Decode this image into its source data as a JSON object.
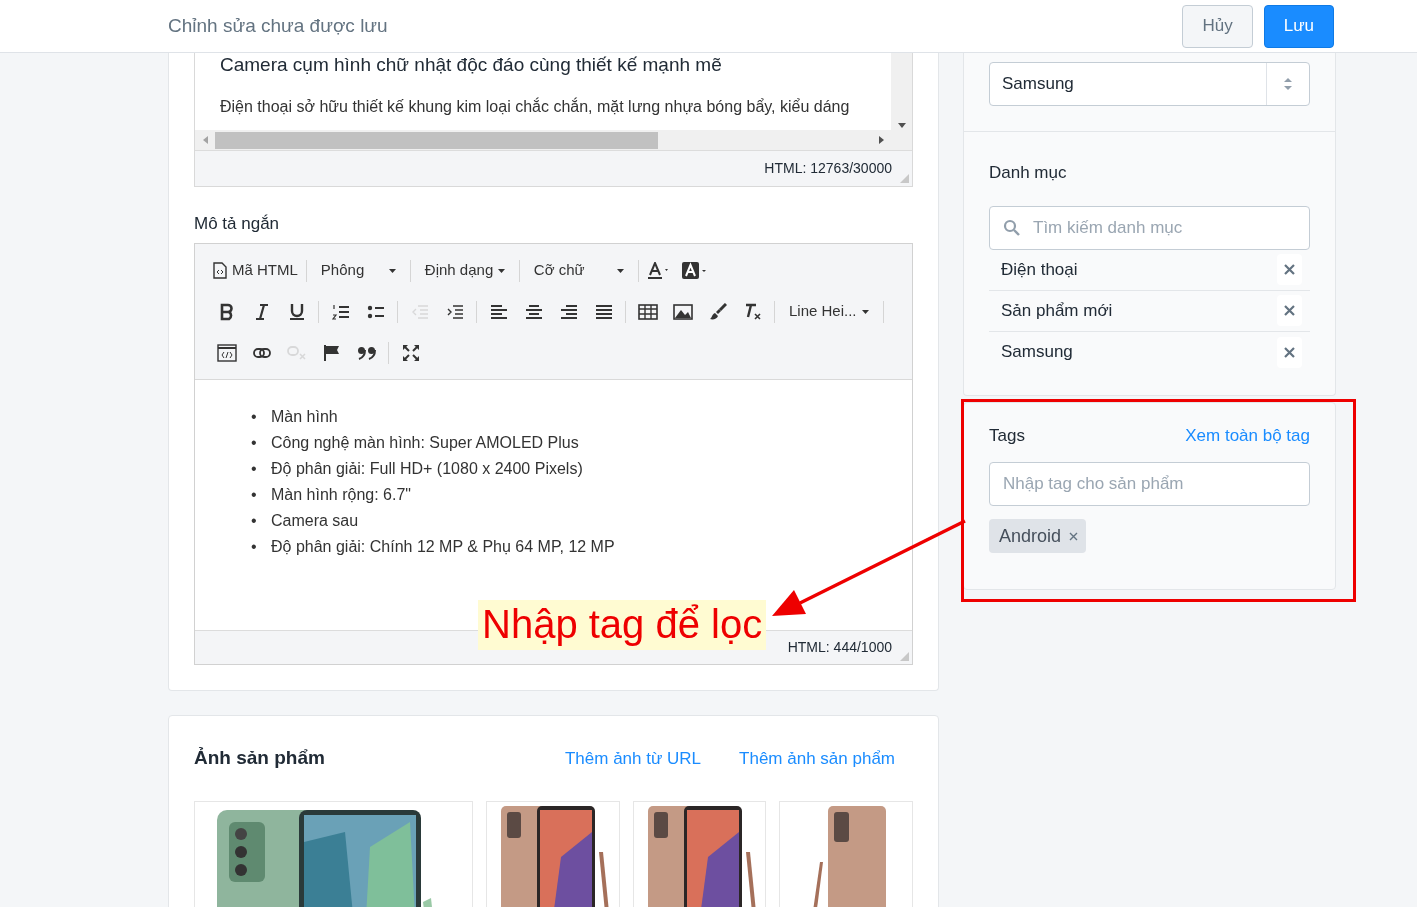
{
  "header": {
    "title": "Chỉnh sửa chưa được lưu",
    "buttons": [
      {
        "label": "Hủy",
        "kind": "secondary"
      },
      {
        "label": "Lưu",
        "kind": "primary"
      }
    ]
  },
  "description_editor": {
    "heading": "Camera cụm hình chữ nhật độc đáo cùng thiết kế mạnh mẽ",
    "paragraph_lines": [
      "Điện thoại sở hữu thiết kế khung kim loại chắc chắn, mặt lưng nhựa bóng bẩy, kiểu dáng"
    ],
    "counter": "HTML: 12763/30000"
  },
  "short_description": {
    "label": "Mô tả ngắn",
    "toolbar": [
      [
        {
          "kind": "button",
          "label": "Mã HTML"
        },
        {
          "kind": "separator"
        },
        {
          "kind": "dropdown",
          "label": "Phông"
        },
        {
          "kind": "separator"
        },
        {
          "kind": "dropdown",
          "label": "Định dạng"
        },
        {
          "kind": "separator"
        },
        {
          "kind": "dropdown",
          "label": "Cỡ chữ"
        },
        {
          "kind": "separator"
        },
        {
          "kind": "icon",
          "disabled": false
        },
        {
          "kind": "icon",
          "disabled": false
        }
      ],
      [
        {
          "kind": "icon",
          "disabled": false
        },
        {
          "kind": "icon",
          "disabled": false
        },
        {
          "kind": "icon",
          "disabled": false
        },
        {
          "kind": "separator"
        },
        {
          "kind": "icon",
          "disabled": false
        },
        {
          "kind": "icon",
          "disabled": false
        },
        {
          "kind": "separator"
        },
        {
          "kind": "icon",
          "disabled": true
        },
        {
          "kind": "icon",
          "disabled": false
        },
        {
          "kind": "separator"
        },
        {
          "kind": "icon",
          "disabled": false
        },
        {
          "kind": "icon",
          "disabled": false
        },
        {
          "kind": "icon",
          "disabled": false
        },
        {
          "kind": "icon",
          "disabled": false
        },
        {
          "kind": "separator"
        },
        {
          "kind": "icon",
          "disabled": false
        },
        {
          "kind": "icon",
          "disabled": false
        },
        {
          "kind": "icon",
          "disabled": false
        },
        {
          "kind": "icon",
          "disabled": false
        },
        {
          "kind": "separator"
        },
        {
          "kind": "dropdown",
          "label": "Line Hei..."
        },
        {
          "kind": "separator"
        }
      ],
      [
        {
          "kind": "icon",
          "disabled": false
        },
        {
          "kind": "icon",
          "disabled": false
        },
        {
          "kind": "icon",
          "disabled": true
        },
        {
          "kind": "icon",
          "disabled": false
        },
        {
          "kind": "icon",
          "disabled": false
        },
        {
          "kind": "separator"
        },
        {
          "kind": "icon",
          "disabled": false
        }
      ]
    ],
    "bullets": [
      {
        "marker": "•",
        "text": "Màn hình"
      },
      {
        "marker": "•",
        "text": "Công nghệ màn hình: Super AMOLED Plus"
      },
      {
        "marker": "•",
        "text": "Độ phân giải: Full HD+ (1080 x 2400 Pixels)"
      },
      {
        "marker": "•",
        "text": "Màn hình rộng: 6.7\""
      },
      {
        "marker": "•",
        "text": "Camera sau"
      },
      {
        "marker": "•",
        "text": "Độ phân giải: Chính 12 MP & Phụ 64 MP, 12 MP"
      }
    ],
    "counter": "HTML: 444/1000"
  },
  "annotation": {
    "text": "Nhập tag để lọc"
  },
  "product_images": {
    "title": "Ảnh sản phẩm",
    "links": [
      "Thêm ảnh từ URL",
      "Thêm ảnh sản phẩm"
    ],
    "images": [
      {
        "kind": "picture"
      },
      {
        "kind": "picture"
      },
      {
        "kind": "picture"
      },
      {
        "kind": "picture"
      }
    ]
  },
  "brand_select": {
    "value": "Samsung"
  },
  "categories": {
    "title": "Danh mục",
    "search_placeholder": "Tìm kiếm danh mục",
    "items": [
      "Điện thoại",
      "Sản phẩm mới",
      "Samsung"
    ]
  },
  "tags": {
    "title": "Tags",
    "link": "Xem toàn bộ tag",
    "placeholder": "Nhập tag cho sản phẩm",
    "items": [
      "Android"
    ]
  }
}
